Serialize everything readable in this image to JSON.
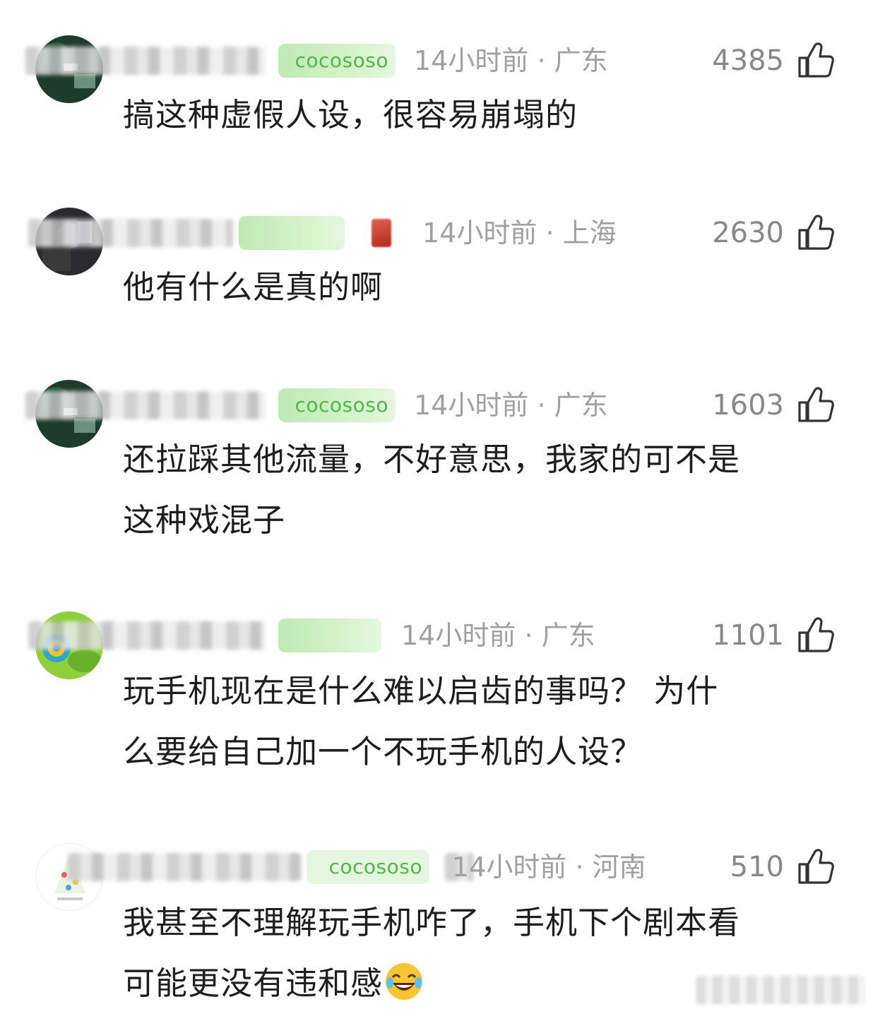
{
  "comments": [
    {
      "badge": "cocososo",
      "time": "14小时前",
      "separator": "·",
      "location": "广东",
      "likes": "4385",
      "text": "搞这种虚假人设，很容易崩塌的"
    },
    {
      "badge": "",
      "time": "14小时前",
      "separator": "·",
      "location": "上海",
      "likes": "2630",
      "text": "他有什么是真的啊"
    },
    {
      "badge": "cocososo",
      "time": "14小时前",
      "separator": "·",
      "location": "广东",
      "likes": "1603",
      "text_lines": [
        "还拉踩其他流量，不好意思，我家的可不是",
        "这种戏混子"
      ]
    },
    {
      "badge": "",
      "time": "14小时前",
      "separator": "·",
      "location": "广东",
      "likes": "1101",
      "text_lines": [
        "玩手机现在是什么难以启齿的事吗？  为什",
        "么要给自己加一个不玩手机的人设？"
      ]
    },
    {
      "badge": "cocososo",
      "time": "14小时前",
      "separator": "·",
      "location": "河南",
      "likes": "510",
      "text_lines": [
        "我甚至不理解玩手机咋了，手机下个剧本看",
        "可能更没有违和感"
      ],
      "emoji": "laughing-crying-emoji"
    }
  ],
  "icons": {
    "like": "thumbs-up-icon"
  },
  "colors": {
    "meta_text": "#a0a0a0",
    "likes_text": "#888888",
    "badge_bg": "#e4f6df",
    "badge_text": "#4fb84a",
    "body_text": "#1e1e1e"
  }
}
